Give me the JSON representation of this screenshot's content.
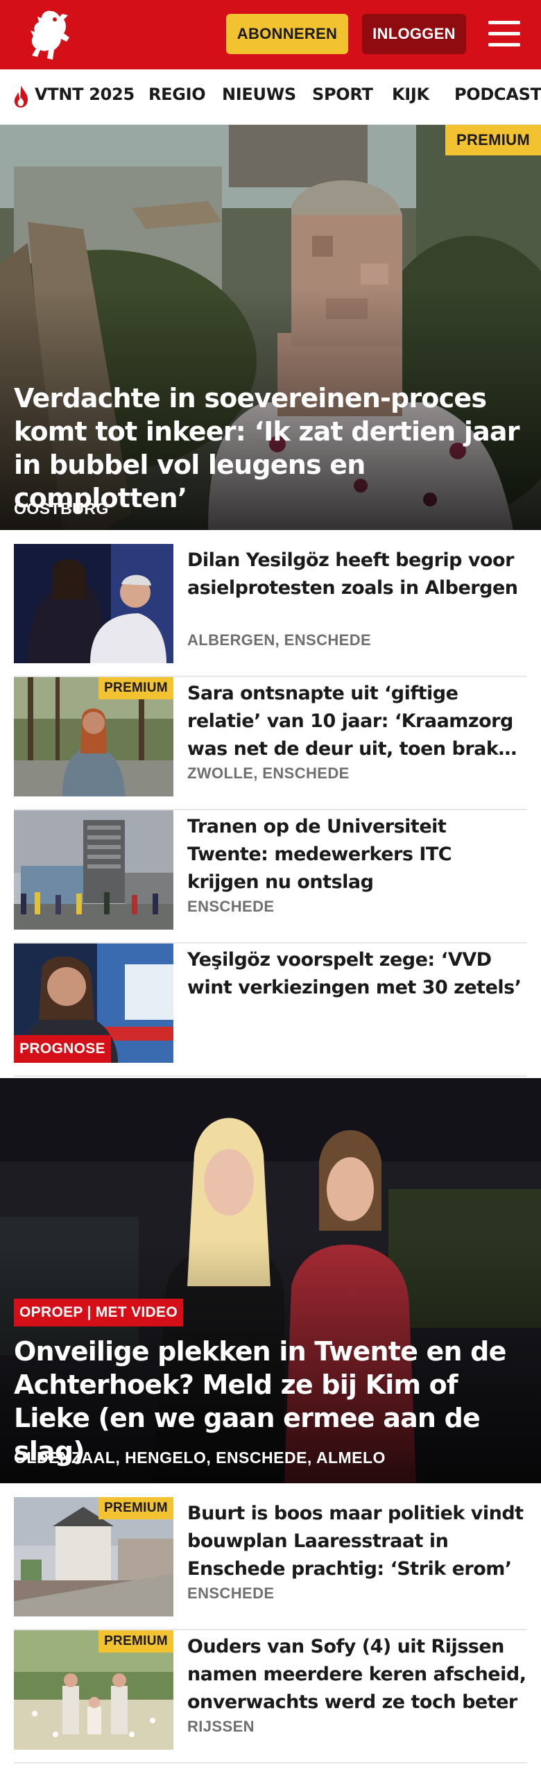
{
  "header": {
    "subscribe_label": "ABONNEREN",
    "login_label": "INLOGGEN",
    "brand_color": "#d40f17",
    "accent_color": "#f2c230",
    "logo_icon": "tubantia-horse-icon",
    "menu_icon": "hamburger-menu-icon"
  },
  "nav": {
    "items": [
      {
        "label": "VTNT 2025",
        "icon": "flame-icon"
      },
      {
        "label": "REGIO"
      },
      {
        "label": "NIEUWS"
      },
      {
        "label": "SPORT"
      },
      {
        "label": "KIJK"
      },
      {
        "label": "PODCAST"
      }
    ]
  },
  "hero1": {
    "badge": "PREMIUM",
    "title": "Verdachte in soevereinen-proces komt tot inkeer: ‘Ik zat dertien jaar in bubbel vol leugens en complotten’",
    "location": "OOSTBURG"
  },
  "articles": [
    {
      "title": "Dilan Yesilgöz heeft begrip voor asielprotesten zoals in Albergen",
      "location": "ALBERGEN, ENSCHEDE"
    },
    {
      "badge": "PREMIUM",
      "title": "Sara ontsnapte uit ‘giftige relatie’ van 10 jaar: ‘Kraamzorg was net de deur uit, toen brak hij los’",
      "location": "ZWOLLE, ENSCHEDE"
    },
    {
      "title": "Tranen op de Universiteit Twente: medewerkers ITC krijgen nu ontslag",
      "location": "ENSCHEDE"
    },
    {
      "badge": "PROGNOSE",
      "title": "Yeşilgöz voorspelt zege: ‘VVD wint verkiezingen met 30 zetels’"
    }
  ],
  "hero2": {
    "label": "OPROEP | MET VIDEO",
    "title": "Onveilige plekken in Twente en de Achterhoek? Meld ze bij Kim of Lieke (en we gaan ermee aan de slag)",
    "location": "OLDENZAAL, HENGELO, ENSCHEDE, ALMELO"
  },
  "articles2": [
    {
      "badge": "PREMIUM",
      "title": "Buurt is boos maar politiek vindt bouwplan Laaresstraat in Enschede prachtig: ‘Strik erom’",
      "location": "ENSCHEDE"
    },
    {
      "badge": "PREMIUM",
      "title": "Ouders van Sofy (4) uit Rijssen namen meerdere keren afscheid, onverwachts werd ze toch beter",
      "location": "RIJSSEN"
    }
  ]
}
